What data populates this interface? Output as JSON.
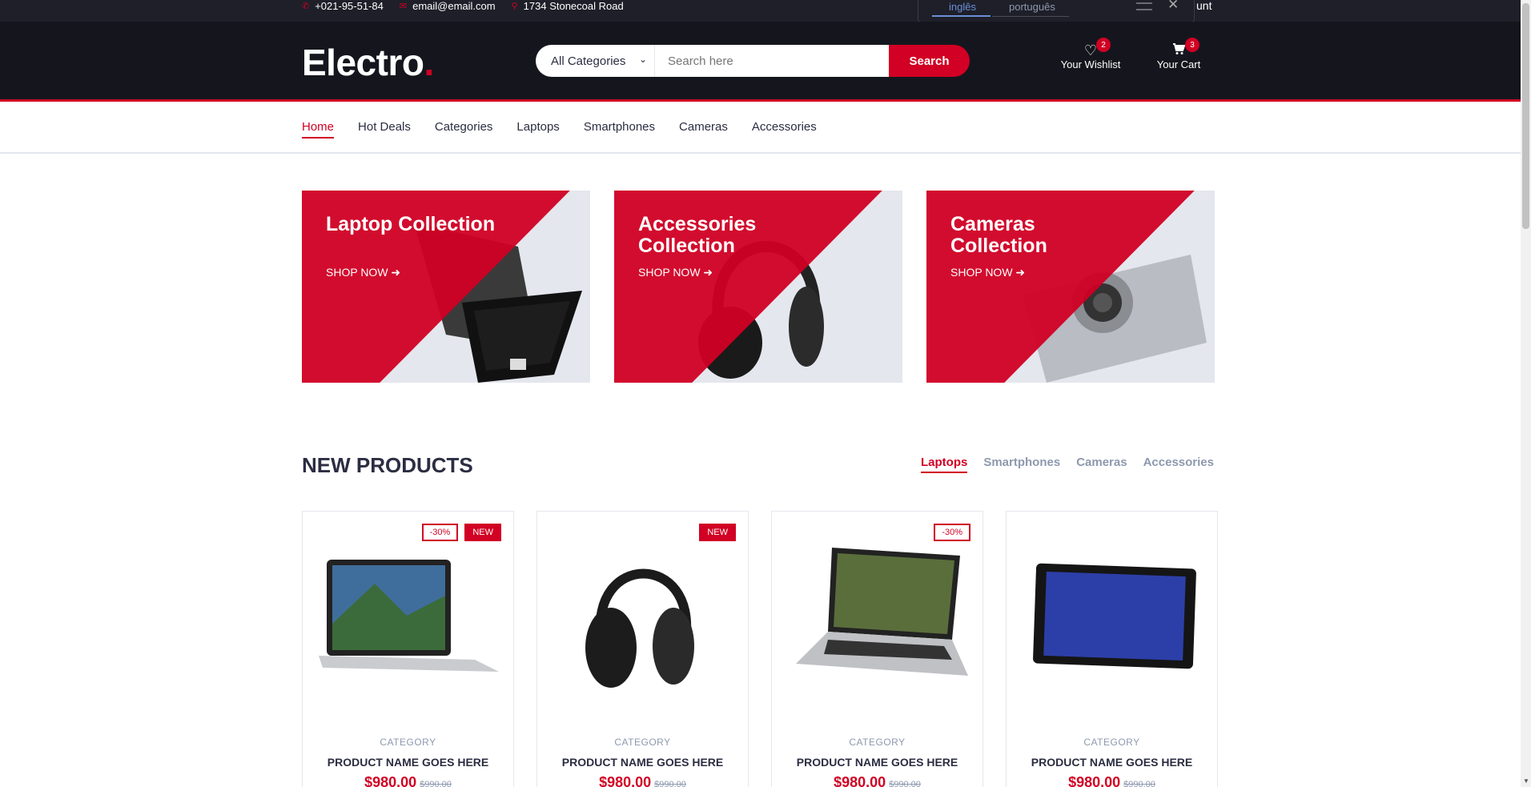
{
  "topbar": {
    "phone": "+021-95-51-84",
    "email": "email@email.com",
    "address": "1734 Stonecoal Road",
    "account_partial": "unt"
  },
  "lang_popup": {
    "tabs": [
      "inglês",
      "português"
    ],
    "close": "✕"
  },
  "header": {
    "logo": "Electro",
    "logo_dot": ".",
    "category_select": "All Categories",
    "search_placeholder": "Search here",
    "search_button": "Search",
    "wishlist_label": "Your Wishlist",
    "wishlist_count": "2",
    "cart_label": "Your Cart",
    "cart_count": "3"
  },
  "nav": {
    "items": [
      "Home",
      "Hot Deals",
      "Categories",
      "Laptops",
      "Smartphones",
      "Cameras",
      "Accessories"
    ]
  },
  "collections": [
    {
      "title": "Laptop Collection",
      "cta": "SHOP NOW"
    },
    {
      "title": "Accessories Collection",
      "cta": "SHOP NOW"
    },
    {
      "title": "Cameras Collection",
      "cta": "SHOP NOW"
    }
  ],
  "new_products": {
    "title": "NEW PRODUCTS",
    "tabs": [
      "Laptops",
      "Smartphones",
      "Cameras",
      "Accessories"
    ],
    "items": [
      {
        "labels": [
          "-30%",
          "NEW"
        ],
        "category": "CATEGORY",
        "name": "PRODUCT NAME GOES HERE",
        "price": "$980.00",
        "old_price": "$990.00"
      },
      {
        "labels": [
          "NEW"
        ],
        "category": "CATEGORY",
        "name": "PRODUCT NAME GOES HERE",
        "price": "$980.00",
        "old_price": "$990.00"
      },
      {
        "labels": [
          "-30%"
        ],
        "category": "CATEGORY",
        "name": "PRODUCT NAME GOES HERE",
        "price": "$980.00",
        "old_price": "$990.00"
      },
      {
        "labels": [],
        "category": "CATEGORY",
        "name": "PRODUCT NAME GOES HERE",
        "price": "$980.00",
        "old_price": "$990.00"
      }
    ]
  },
  "colors": {
    "accent": "#D10024",
    "header_bg": "#15161D",
    "topbar_bg": "#1E1F29",
    "text": "#2B2D42",
    "muted": "#8D99AE"
  }
}
